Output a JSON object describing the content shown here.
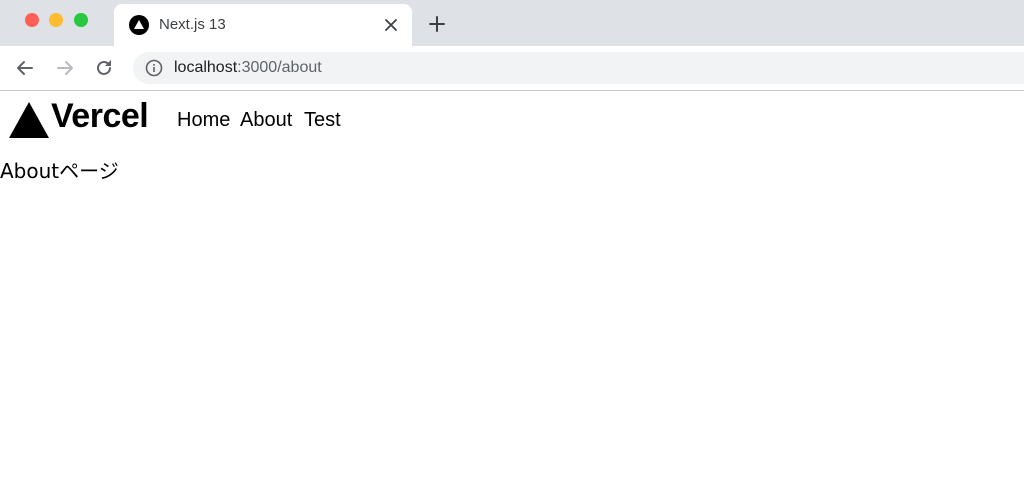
{
  "browser": {
    "tab": {
      "title": "Next.js 13",
      "favicon_icon": "nextjs-triangle-icon",
      "close_icon": "close-icon"
    },
    "new_tab_icon": "plus-icon",
    "toolbar": {
      "back_icon": "arrow-left-icon",
      "forward_icon": "arrow-right-icon",
      "reload_icon": "reload-icon",
      "info_icon": "info-icon"
    },
    "address_bar": {
      "host": "localhost",
      "path": ":3000/about"
    }
  },
  "page": {
    "logo": {
      "wordmark": "Vercel",
      "icon": "vercel-triangle-icon"
    },
    "nav": {
      "home": "Home",
      "about": "About",
      "test": "Test"
    },
    "content_text": "Aboutページ"
  },
  "colors": {
    "titlebar_bg": "#dee1e6",
    "omnibox_bg": "#f1f3f4",
    "traffic_red": "#ff5f57",
    "traffic_yellow": "#febc2e",
    "traffic_green": "#28c840"
  }
}
